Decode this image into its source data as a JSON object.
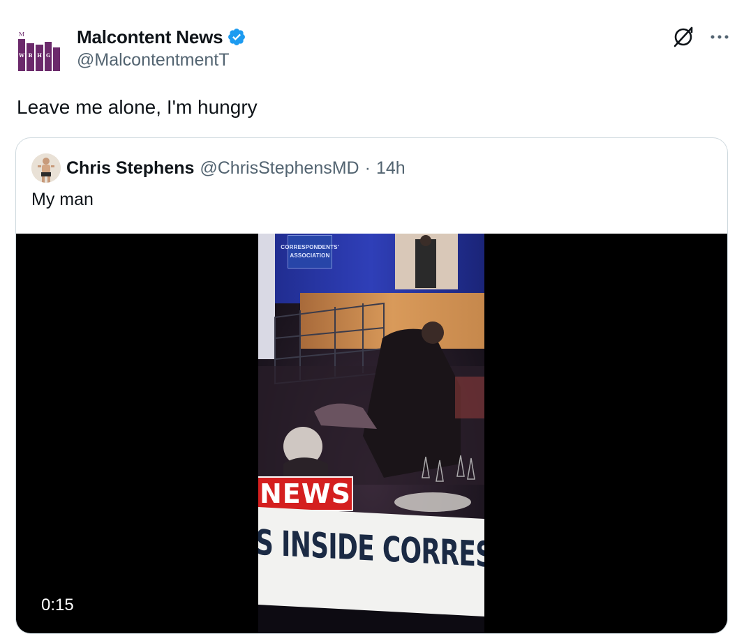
{
  "post": {
    "author_name": "Malcontent News",
    "author_handle": "@MalcontentmentT",
    "avatar_letters": [
      "M",
      "W",
      "B",
      "H",
      "G"
    ],
    "text": "Leave me alone, I'm hungry",
    "verified": true
  },
  "quote": {
    "author_name": "Chris Stephens",
    "author_handle": "@ChrisStephensMD",
    "separator": "·",
    "time": "14h",
    "text": "My man",
    "video": {
      "duration": "0:15",
      "news_bug": "NEWS",
      "lower_third": "S INSIDE CORRESPON",
      "banner_line1": "CORRESPONDENTS'",
      "banner_line2": "ASSOCIATION"
    }
  },
  "icons": {
    "verified": "verified-badge-icon",
    "grok": "grok-icon",
    "more": "more-icon"
  },
  "colors": {
    "text_primary": "#0f1419",
    "text_secondary": "#536471",
    "border": "#cfd9de",
    "verified_blue": "#1d9bf0",
    "logo_purple": "#6b2a6b"
  }
}
